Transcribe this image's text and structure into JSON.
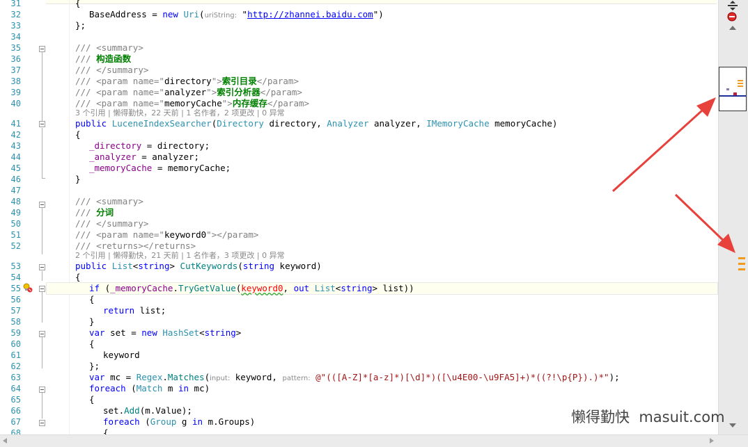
{
  "lines": [
    {
      "n": "31",
      "code": "{"
    },
    {
      "n": "32",
      "code": "BaseAddress = new Uri(uriString: \"http://zhannei.baidu.com\")"
    },
    {
      "n": "33",
      "code": "};"
    },
    {
      "n": "34",
      "code": ""
    },
    {
      "n": "35",
      "code": "/// <summary>"
    },
    {
      "n": "36",
      "code": "/// 构造函数"
    },
    {
      "n": "37",
      "code": "/// </summary>"
    },
    {
      "n": "38",
      "code": "/// <param name=\"directory\">索引目录</param>"
    },
    {
      "n": "39",
      "code": "/// <param name=\"analyzer\">索引分析器</param>"
    },
    {
      "n": "40",
      "code": "/// <param name=\"memoryCache\">内存缓存</param>"
    },
    {
      "n": "41",
      "code": "public LuceneIndexSearcher(Directory directory, Analyzer analyzer, IMemoryCache memoryCache)"
    },
    {
      "n": "42",
      "code": "{"
    },
    {
      "n": "43",
      "code": "_directory = directory;"
    },
    {
      "n": "44",
      "code": "_analyzer = analyzer;"
    },
    {
      "n": "45",
      "code": "_memoryCache = memoryCache;"
    },
    {
      "n": "46",
      "code": "}"
    },
    {
      "n": "47",
      "code": ""
    },
    {
      "n": "48",
      "code": "/// <summary>"
    },
    {
      "n": "49",
      "code": "/// 分词"
    },
    {
      "n": "50",
      "code": "/// </summary>"
    },
    {
      "n": "51",
      "code": "/// <param name=\"keyword0\"></param>"
    },
    {
      "n": "52",
      "code": "/// <returns></returns>"
    },
    {
      "n": "53",
      "code": "public List<string> CutKeywords(string keyword)"
    },
    {
      "n": "54",
      "code": "{"
    },
    {
      "n": "55",
      "code": "if (_memoryCache.TryGetValue(keyword0, out List<string> list))"
    },
    {
      "n": "56",
      "code": "{"
    },
    {
      "n": "57",
      "code": "return list;"
    },
    {
      "n": "58",
      "code": "}"
    },
    {
      "n": "59",
      "code": "var set = new HashSet<string>"
    },
    {
      "n": "60",
      "code": "{"
    },
    {
      "n": "61",
      "code": "keyword"
    },
    {
      "n": "62",
      "code": "};"
    },
    {
      "n": "63",
      "code": "var mc = Regex.Matches(input: keyword, pattern: @\"(([A-Z]*[a-z]*)[\\d]*)([\\u4E00-\\u9FA5]+)*((?!\\p{P}).)*\");"
    },
    {
      "n": "64",
      "code": "foreach (Match m in mc)"
    },
    {
      "n": "65",
      "code": "{"
    },
    {
      "n": "66",
      "code": "set.Add(m.Value);"
    },
    {
      "n": "67",
      "code": "foreach (Group g in m.Groups)"
    },
    {
      "n": "68",
      "code": "{"
    }
  ],
  "code_lens": [
    {
      "before_line": "41",
      "text": "3 个引用 | 懒得勤快，22 天前 | 1 名作者，2 项更改 | 0 异常"
    },
    {
      "before_line": "53",
      "text": "2 个引用 | 懒得勤快，21 天前 | 1 名作者，3 项更改 | 0 异常"
    }
  ],
  "hints": {
    "uriString": "uriString:",
    "input": "input:",
    "pattern": "pattern:"
  },
  "url": "http://zhannei.baidu.com",
  "watermark": "懒得勤快  masuit.com",
  "colors": {
    "keyword": "#0000ff",
    "type": "#2b91af",
    "comment": "#808080",
    "field": "#8b008b",
    "string": "#a31515",
    "arrow": "#e8403a"
  },
  "icons": [
    "split-window-icon",
    "error-icon",
    "scroll-up-icon",
    "scroll-down-icon",
    "lightbulb-icon",
    "fold-icon"
  ]
}
